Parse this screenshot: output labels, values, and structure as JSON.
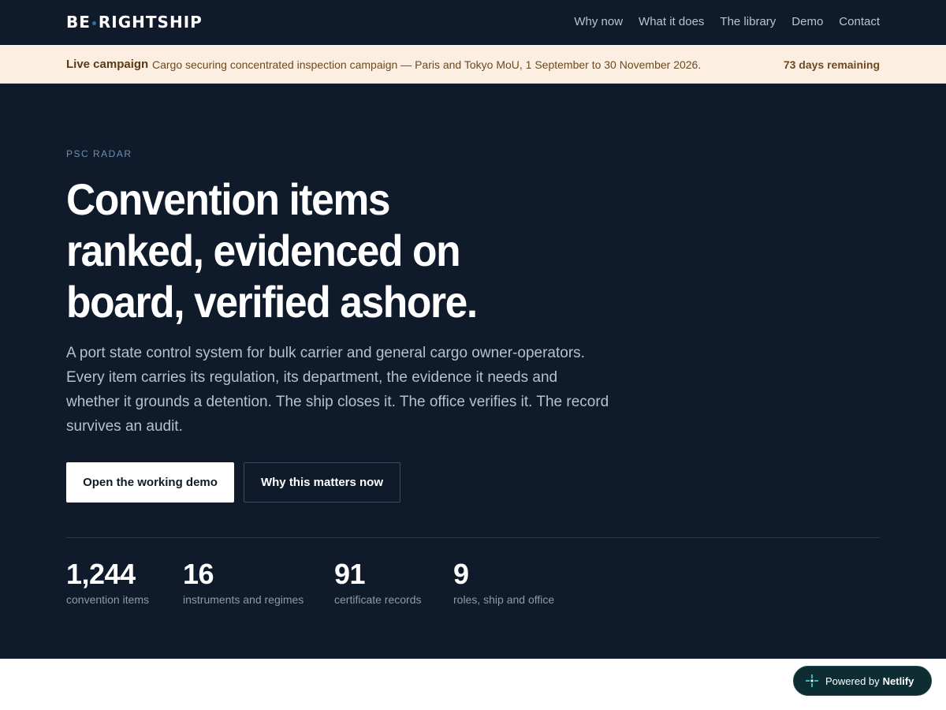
{
  "brand": {
    "name_left": "BE",
    "name_right": "RIGHTSHIP"
  },
  "nav": [
    "Why now",
    "What it does",
    "The library",
    "Demo",
    "Contact"
  ],
  "banner": {
    "label": "Live campaign",
    "message": "Cargo securing concentrated inspection campaign — Paris and Tokyo MoU, 1 September to 30 November 2026.",
    "remaining": "73 days remaining"
  },
  "hero": {
    "eyebrow": "PSC RADAR",
    "title": "Convention items ranked, evidenced on board, verified ashore.",
    "lede": "A port state control system for bulk carrier and general cargo owner-operators. Every item carries its regulation, its department, the evidence it needs and whether it grounds a detention. The ship closes it. The office verifies it. The record survives an audit.",
    "primary_cta": "Open the working demo",
    "secondary_cta": "Why this matters now"
  },
  "stats": [
    {
      "value": "1,244",
      "caption": "convention items"
    },
    {
      "value": "16",
      "caption": "instruments and regimes"
    },
    {
      "value": "91",
      "caption": "certificate records"
    },
    {
      "value": "9",
      "caption": "roles, ship and office"
    }
  ],
  "badge": {
    "prefix": "Powered by",
    "name": "Netlify"
  },
  "colors": {
    "navy": "#0f1a2a",
    "banner_bg": "#fcefe1",
    "banner_text": "#6b4a22",
    "accent_dot": "#2f6db5"
  }
}
